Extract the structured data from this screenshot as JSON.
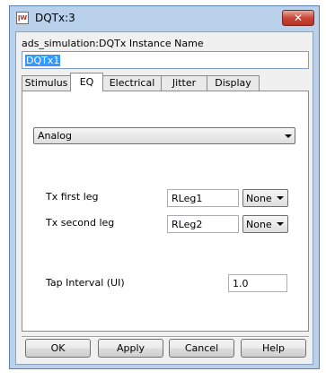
{
  "window": {
    "title": "DQTx:3",
    "icon_glyph": "ǀW",
    "close_glyph": "✕"
  },
  "instance": {
    "label": "ads_simulation:DQTx Instance Name",
    "value": "DQTx1"
  },
  "tabs": [
    {
      "label": "Stimulus",
      "active": false
    },
    {
      "label": "EQ",
      "active": true
    },
    {
      "label": "Electrical",
      "active": false
    },
    {
      "label": "Jitter",
      "active": false
    },
    {
      "label": "Display",
      "active": false
    }
  ],
  "eq": {
    "mode": "Analog",
    "tx_first_leg": {
      "label": "Tx first leg",
      "value": "RLeg1",
      "unit": "None"
    },
    "tx_second_leg": {
      "label": "Tx second leg",
      "value": "RLeg2",
      "unit": "None"
    },
    "tap_interval": {
      "label": "Tap Interval (UI)",
      "value": "1.0"
    }
  },
  "buttons": {
    "ok": "OK",
    "apply": "Apply",
    "cancel": "Cancel",
    "help": "Help"
  }
}
